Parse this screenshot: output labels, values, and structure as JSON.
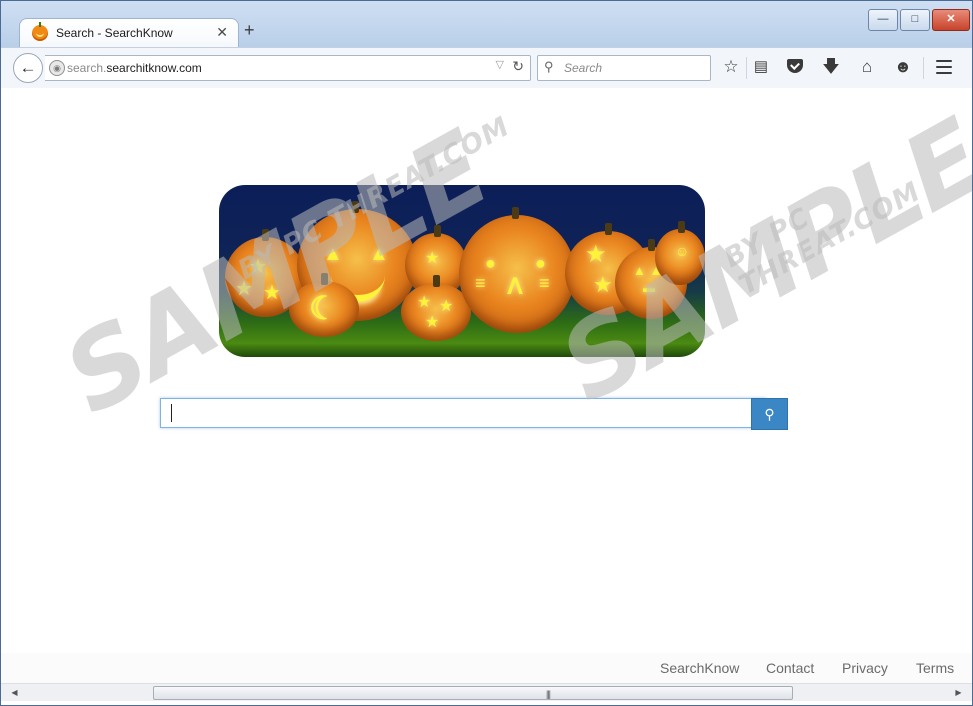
{
  "browser": {
    "tab_title": "Search - SearchKnow",
    "tab_close": "✕",
    "new_tab": "+",
    "url_host": "search.",
    "url_domain": "searchitknow.com",
    "search_placeholder": "Search",
    "window_controls": {
      "minimize": "—",
      "maximize": "□",
      "close": "✕"
    },
    "icons": [
      "back-arrow-icon",
      "globe-icon",
      "dropdown-triangle-icon",
      "reload-icon",
      "search-icon",
      "bookmark-star-icon",
      "reading-list-icon",
      "pocket-icon",
      "download-icon",
      "home-icon",
      "chat-icon",
      "menu-icon"
    ]
  },
  "page": {
    "search_value": "",
    "banner_theme": "halloween-pumpkins",
    "search_button_icon": "magnifier-icon",
    "footer_links": [
      "SearchKnow",
      "Contact",
      "Privacy",
      "Terms"
    ]
  },
  "watermark": {
    "big": "SAMPLE",
    "small": "BY PC THREAT.COM"
  },
  "colors": {
    "search_button": "#3b87c6",
    "titlebar": "#b9cfe9"
  }
}
